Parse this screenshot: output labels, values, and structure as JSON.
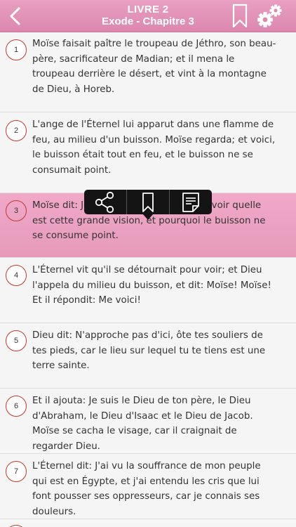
{
  "header": {
    "book": "LIVRE 2",
    "chapter": "Exode - Chapitre 3",
    "back_icon": "chevron-left-icon",
    "bookmark_icon": "bookmark-icon",
    "settings_icon": "gear-icon"
  },
  "popup": {
    "share_icon": "share-icon",
    "bookmark_icon": "bookmark-icon",
    "note_icon": "note-icon"
  },
  "verses": [
    {
      "num": "1",
      "text": "Moïse faisait paître le troupeau de Jéthro, son beau-père, sacrificateur de Madian; et il mena le troupeau derrière le désert, et vint à la montagne de Dieu, à Horeb."
    },
    {
      "num": "2",
      "text": "L'ange de l'Éternel lui apparut dans une flamme de feu, au milieu d'un buisson. Moïse regarda; et voici, le buisson était tout en feu, et le buisson ne se consumait point."
    },
    {
      "num": "3",
      "text": "Moïse dit: Je vais faire un détour pour voir quelle est cette grande vision, et pourquoi le buisson ne se consume point."
    },
    {
      "num": "4",
      "text": "L'Éternel vit qu'il se détournait pour voir; et Dieu l'appela du milieu du buisson, et dit: Moïse! Moïse! Et il répondit: Me voici!"
    },
    {
      "num": "5",
      "text": "Dieu dit: N'approche pas d'ici, ôte tes souliers de tes pieds, car le lieu sur lequel tu te tiens est une terre sainte."
    },
    {
      "num": "6",
      "text": "Et il ajouta: Je suis le Dieu de ton père, le Dieu d'Abraham, le Dieu d'Isaac et le Dieu de Jacob. Moïse se cacha le visage, car il craignait de regarder Dieu."
    },
    {
      "num": "7",
      "text": "L'Éternel dit: J'ai vu la souffrance de mon peuple qui est en Égypte, et j'ai entendu les cris que lui font pousser ses oppresseurs, car je connais ses douleurs."
    }
  ],
  "colors": {
    "header": "#dc87ae",
    "selected_row": "#eba2c2",
    "number_ring": "#c0392b"
  }
}
